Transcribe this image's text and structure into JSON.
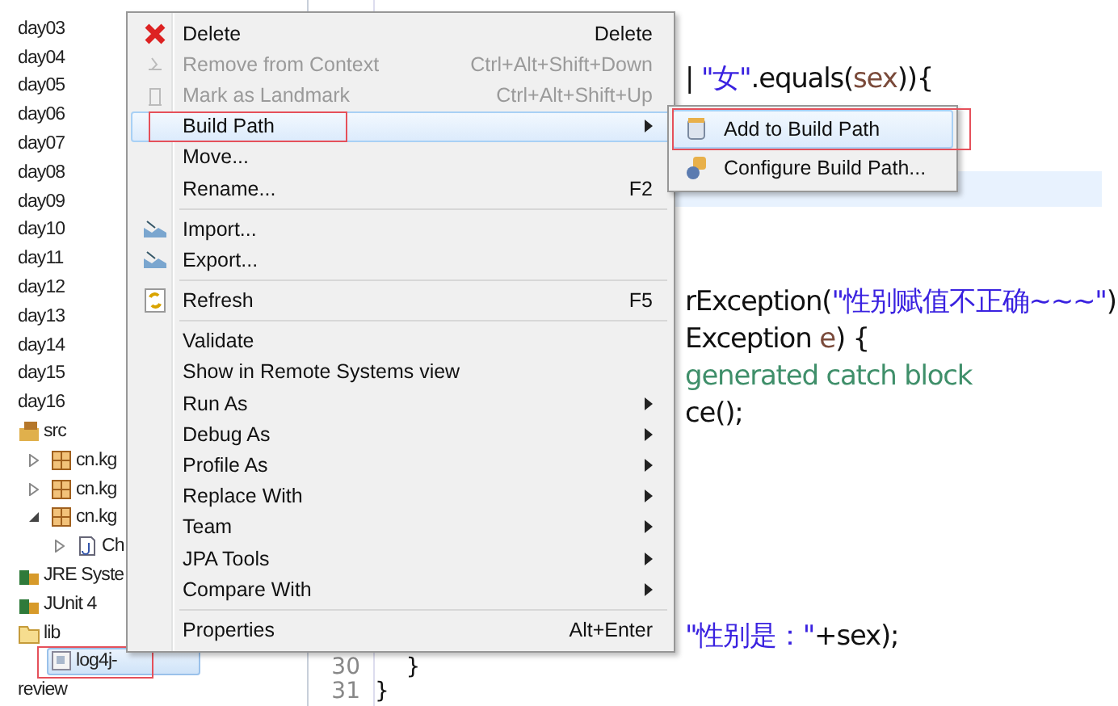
{
  "tree": {
    "items": [
      {
        "label": "day03",
        "kind": "folder_plain",
        "selected": false,
        "framed": false
      },
      {
        "label": "day04",
        "kind": "folder_plain",
        "selected": false,
        "framed": false
      },
      {
        "label": "day05",
        "kind": "folder_plain",
        "selected": false,
        "framed": false
      },
      {
        "label": "day06",
        "kind": "folder_plain",
        "selected": false,
        "framed": false
      },
      {
        "label": "day07",
        "kind": "folder_plain",
        "selected": false,
        "framed": false
      },
      {
        "label": "day08",
        "kind": "folder_plain",
        "selected": false,
        "framed": false
      },
      {
        "label": "day09",
        "kind": "folder_plain",
        "selected": false,
        "framed": false
      },
      {
        "label": "day10",
        "kind": "folder_plain",
        "selected": false,
        "framed": false
      },
      {
        "label": "day11",
        "kind": "folder_plain",
        "selected": false,
        "framed": false
      },
      {
        "label": "day12",
        "kind": "folder_plain",
        "selected": false,
        "framed": false
      },
      {
        "label": "day13",
        "kind": "folder_plain",
        "selected": false,
        "framed": false
      },
      {
        "label": "day14",
        "kind": "folder_plain",
        "selected": false,
        "framed": false
      },
      {
        "label": "day15",
        "kind": "folder_plain",
        "selected": false,
        "framed": false
      },
      {
        "label": "day16",
        "kind": "folder_plain",
        "selected": false,
        "framed": false
      },
      {
        "label": "src",
        "kind": "source",
        "selected": false,
        "framed": false,
        "children": [
          {
            "label": "cn.kg",
            "kind": "package",
            "expanded": false,
            "selected": false,
            "framed": false
          },
          {
            "label": "cn.kg",
            "kind": "package",
            "expanded": false,
            "selected": false,
            "framed": false
          },
          {
            "label": "cn.kg",
            "kind": "package",
            "expanded": true,
            "selected": false,
            "framed": false,
            "children": [
              {
                "label": "Ch",
                "kind": "class",
                "expanded": false,
                "selected": false,
                "framed": false
              }
            ]
          }
        ]
      },
      {
        "label": "JRE Syste",
        "kind": "library",
        "selected": false,
        "framed": false
      },
      {
        "label": "JUnit 4",
        "kind": "library",
        "selected": false,
        "framed": false
      },
      {
        "label": "lib",
        "kind": "folder",
        "selected": false,
        "framed": false,
        "children": [
          {
            "label": "log4j-",
            "kind": "jar",
            "selected": true,
            "framed": true
          }
        ]
      },
      {
        "label": "review",
        "kind": "folder_plain",
        "selected": false,
        "framed": false
      }
    ]
  },
  "editor": {
    "lines": [
      {
        "segments": [
          {
            "text": "| ",
            "kind": "plain"
          },
          {
            "text": "\"女\"",
            "kind": "string"
          },
          {
            "text": ".equals(",
            "kind": "plain"
          },
          {
            "text": "sex",
            "kind": "variable"
          },
          {
            "text": ")){",
            "kind": "plain"
          }
        ]
      },
      {
        "segments": [
          {
            "text": "rException(",
            "kind": "plain"
          },
          {
            "text": "\"性别赋值不正确~~~\"",
            "kind": "string"
          },
          {
            "text": ")",
            "kind": "plain"
          }
        ]
      },
      {
        "segments": [
          {
            "text": "Exception ",
            "kind": "plain"
          },
          {
            "text": "e",
            "kind": "variable"
          },
          {
            "text": ") {",
            "kind": "plain"
          }
        ]
      },
      {
        "segments": [
          {
            "text": "generated catch block",
            "kind": "comment"
          }
        ]
      },
      {
        "segments": [
          {
            "text": "ce();",
            "kind": "plain"
          }
        ]
      },
      {
        "segments": [
          {
            "text": "\"性别是：\"",
            "kind": "string"
          },
          {
            "text": "+sex);",
            "kind": "plain"
          }
        ]
      },
      {
        "number": "30",
        "segments": [
          {
            "text": "}",
            "kind": "plain"
          }
        ]
      },
      {
        "number": "31",
        "segments": [
          {
            "text": "}",
            "kind": "plain"
          }
        ]
      }
    ]
  },
  "context_menu": {
    "items": [
      {
        "kind": "item",
        "label": "Delete",
        "shortcut": "Delete",
        "disabled": false,
        "submenu": false,
        "selected": false,
        "framed": false
      },
      {
        "kind": "item",
        "label": "Remove from Context",
        "shortcut": "Ctrl+Alt+Shift+Down",
        "disabled": true,
        "submenu": false,
        "selected": false,
        "framed": false
      },
      {
        "kind": "item",
        "label": "Mark as Landmark",
        "shortcut": "Ctrl+Alt+Shift+Up",
        "disabled": true,
        "submenu": false,
        "selected": false,
        "framed": false
      },
      {
        "kind": "item",
        "label": "Build Path",
        "disabled": false,
        "submenu": true,
        "selected": true,
        "framed": true
      },
      {
        "kind": "item",
        "label": "Move...",
        "disabled": false,
        "submenu": false,
        "selected": false,
        "framed": false
      },
      {
        "kind": "item",
        "label": "Rename...",
        "shortcut": "F2",
        "disabled": false,
        "submenu": false,
        "selected": false,
        "framed": false
      },
      {
        "kind": "separator"
      },
      {
        "kind": "item",
        "label": "Import...",
        "disabled": false,
        "submenu": false,
        "selected": false,
        "framed": false
      },
      {
        "kind": "item",
        "label": "Export...",
        "disabled": false,
        "submenu": false,
        "selected": false,
        "framed": false
      },
      {
        "kind": "separator"
      },
      {
        "kind": "item",
        "label": "Refresh",
        "shortcut": "F5",
        "disabled": false,
        "submenu": false,
        "selected": false,
        "framed": false
      },
      {
        "kind": "separator"
      },
      {
        "kind": "item",
        "label": "Validate",
        "disabled": false,
        "submenu": false,
        "selected": false,
        "framed": false
      },
      {
        "kind": "item",
        "label": "Show in Remote Systems view",
        "disabled": false,
        "submenu": false,
        "selected": false,
        "framed": false
      },
      {
        "kind": "item",
        "label": "Run As",
        "disabled": false,
        "submenu": true,
        "selected": false,
        "framed": false
      },
      {
        "kind": "item",
        "label": "Debug As",
        "disabled": false,
        "submenu": true,
        "selected": false,
        "framed": false
      },
      {
        "kind": "item",
        "label": "Profile As",
        "disabled": false,
        "submenu": true,
        "selected": false,
        "framed": false
      },
      {
        "kind": "item",
        "label": "Replace With",
        "disabled": false,
        "submenu": true,
        "selected": false,
        "framed": false
      },
      {
        "kind": "item",
        "label": "Team",
        "disabled": false,
        "submenu": true,
        "selected": false,
        "framed": false
      },
      {
        "kind": "item",
        "label": "JPA Tools",
        "disabled": false,
        "submenu": true,
        "selected": false,
        "framed": false
      },
      {
        "kind": "item",
        "label": "Compare With",
        "disabled": false,
        "submenu": true,
        "selected": false,
        "framed": false
      },
      {
        "kind": "separator"
      },
      {
        "kind": "item",
        "label": "Properties",
        "shortcut": "Alt+Enter",
        "disabled": false,
        "submenu": false,
        "selected": false,
        "framed": false
      }
    ]
  },
  "submenu": {
    "items": [
      {
        "label": "Add to Build Path",
        "selected": true,
        "framed": true
      },
      {
        "label": "Configure Build Path...",
        "selected": false,
        "framed": false
      }
    ]
  }
}
